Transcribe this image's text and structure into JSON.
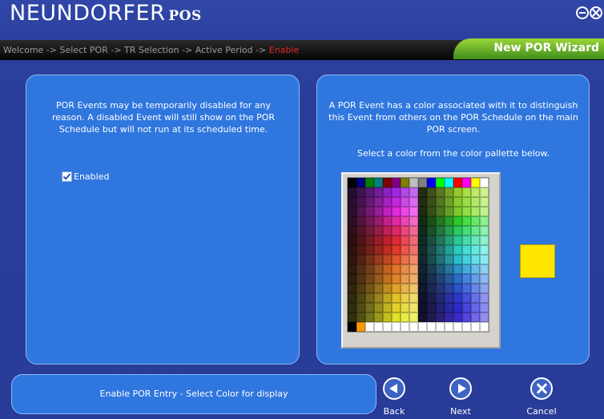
{
  "window": {
    "brand": "NEUNDORFER",
    "brand_suffix": "POS",
    "wizard_title": "New POR Wizard"
  },
  "breadcrumb": {
    "trail": "Welcome -> Select POR -> TR Selection -> Active Period -> ",
    "current": "Enable"
  },
  "left_panel": {
    "description": "POR Events may be temporarily disabled for any reason. A disabled Event will still show on the POR Schedule but will not run at its scheduled time.",
    "enabled_label": "Enabled",
    "enabled_checked": true
  },
  "right_panel": {
    "description": "A POR Event has a color associated with it to distinguish this Event from others on the POR Schedule on the main POR screen.",
    "select_prompt": "Select a color from the color pallette below.",
    "selected_color": "#ffe600"
  },
  "status": {
    "text": "Enable POR Entry - Select Color for display"
  },
  "nav": {
    "back": "Back",
    "next": "Next",
    "cancel": "Cancel"
  },
  "colors": {
    "background": "#2b3f9c",
    "panel": "#2f76df",
    "wizard_tab": "#6cb82a",
    "breadcrumb_active": "#e0292b"
  }
}
